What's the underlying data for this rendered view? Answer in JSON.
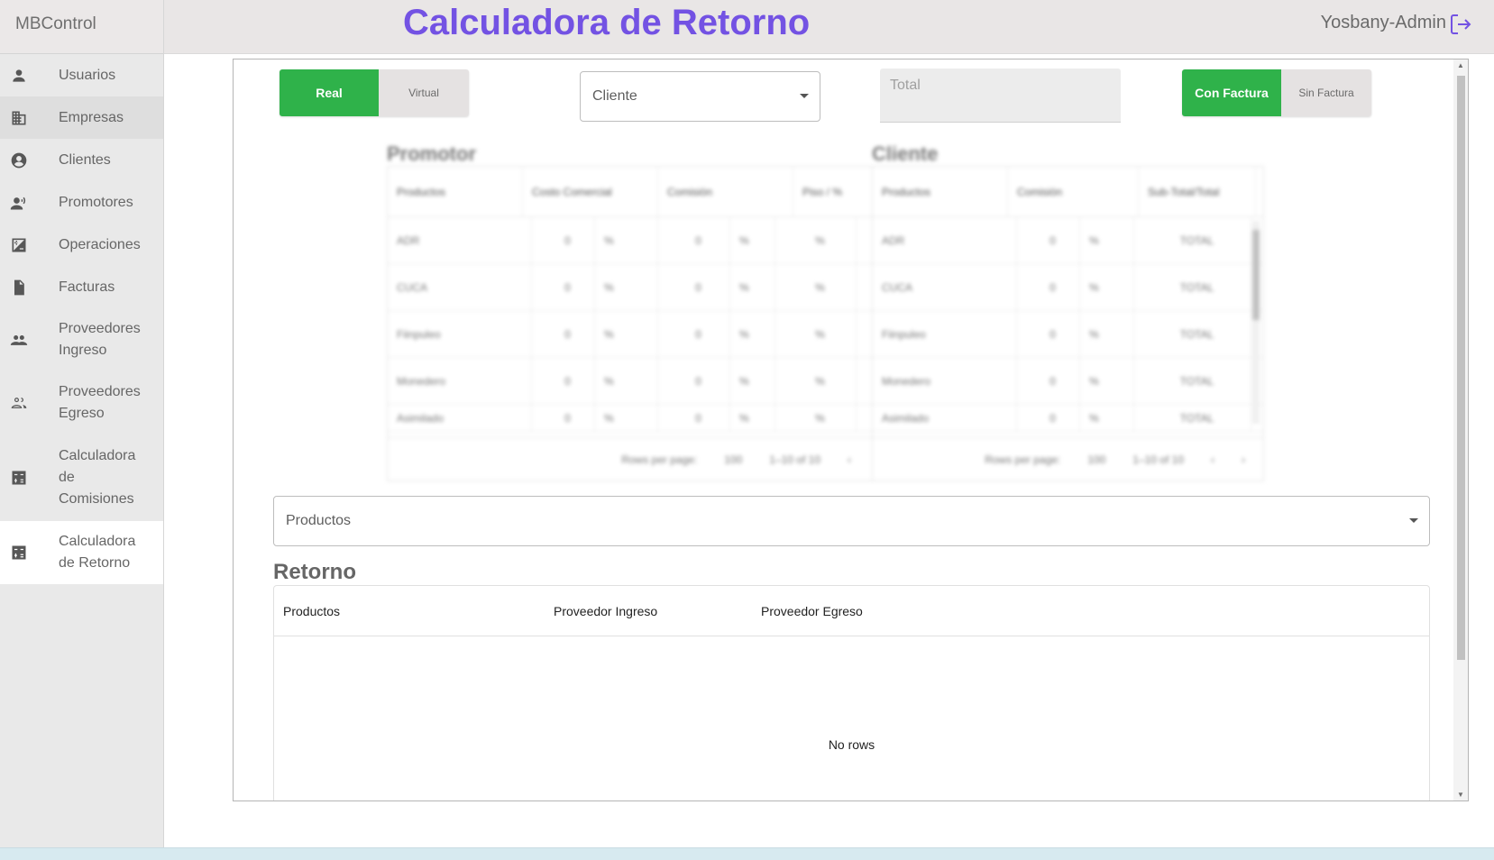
{
  "app": {
    "brand": "MBControl",
    "title": "Calculadora de Retorno",
    "user": "Yosbany-Admin"
  },
  "sidebar": {
    "items": [
      {
        "label": "Usuarios",
        "icon": "person-icon"
      },
      {
        "label": "Empresas",
        "icon": "building-icon"
      },
      {
        "label": "Clientes",
        "icon": "account-circle-icon"
      },
      {
        "label": "Promotores",
        "icon": "record-voice-icon"
      },
      {
        "label": "Operaciones",
        "icon": "plus-minus-box-icon"
      },
      {
        "label": "Facturas",
        "icon": "document-icon"
      },
      {
        "label": "Proveedores Ingreso",
        "icon": "group-icon"
      },
      {
        "label": "Proveedores Egreso",
        "icon": "group-outline-icon"
      },
      {
        "label": "Calculadora de Comisiones",
        "icon": "calculator-icon"
      },
      {
        "label": "Calculadora de Retorno",
        "icon": "calculator-icon"
      }
    ]
  },
  "controls": {
    "mode_on": "Real",
    "mode_off": "Virtual",
    "cliente_placeholder": "Cliente",
    "total_placeholder": "Total",
    "factura_on": "Con Factura",
    "factura_off": "Sin Factura"
  },
  "promotor_table": {
    "title": "Promotor",
    "headers": [
      "Productos",
      "Costo Comercial",
      "Comisión",
      "Piso / %"
    ],
    "rows": [
      [
        "ADR",
        "0",
        "%",
        "0",
        "%",
        "%"
      ],
      [
        "CUCA",
        "0",
        "%",
        "0",
        "%",
        "%"
      ],
      [
        "Fiinpuleo",
        "0",
        "%",
        "0",
        "%",
        "%"
      ],
      [
        "Monedero",
        "0",
        "%",
        "0",
        "%",
        "%"
      ],
      [
        "Asimilado",
        "0",
        "%",
        "0",
        "%",
        "%"
      ]
    ],
    "footer_rows_label": "Rows per page:",
    "footer_rows_value": "100",
    "footer_range": "1–10 of 10"
  },
  "cliente_table": {
    "title": "Cliente",
    "headers": [
      "Productos",
      "Comisión",
      "Sub-Total/Total"
    ],
    "rows": [
      [
        "ADR",
        "0",
        "%",
        "TOTAL"
      ],
      [
        "CUCA",
        "0",
        "%",
        "TOTAL"
      ],
      [
        "Fiinpuleo",
        "0",
        "%",
        "TOTAL"
      ],
      [
        "Monedero",
        "0",
        "%",
        "TOTAL"
      ],
      [
        "Asimilado",
        "0",
        "%",
        "TOTAL"
      ]
    ],
    "footer_rows_label": "Rows per page:",
    "footer_rows_value": "100",
    "footer_range": "1–10 of 10"
  },
  "productos_select": {
    "placeholder": "Productos"
  },
  "retorno": {
    "title": "Retorno",
    "headers": [
      "Productos",
      "Proveedor Ingreso",
      "Proveedor Egreso"
    ],
    "empty_text": "No rows"
  },
  "colors": {
    "accent": "#7352e3",
    "green": "#2fb24a",
    "sidebar_bg": "#e9e9e9"
  }
}
